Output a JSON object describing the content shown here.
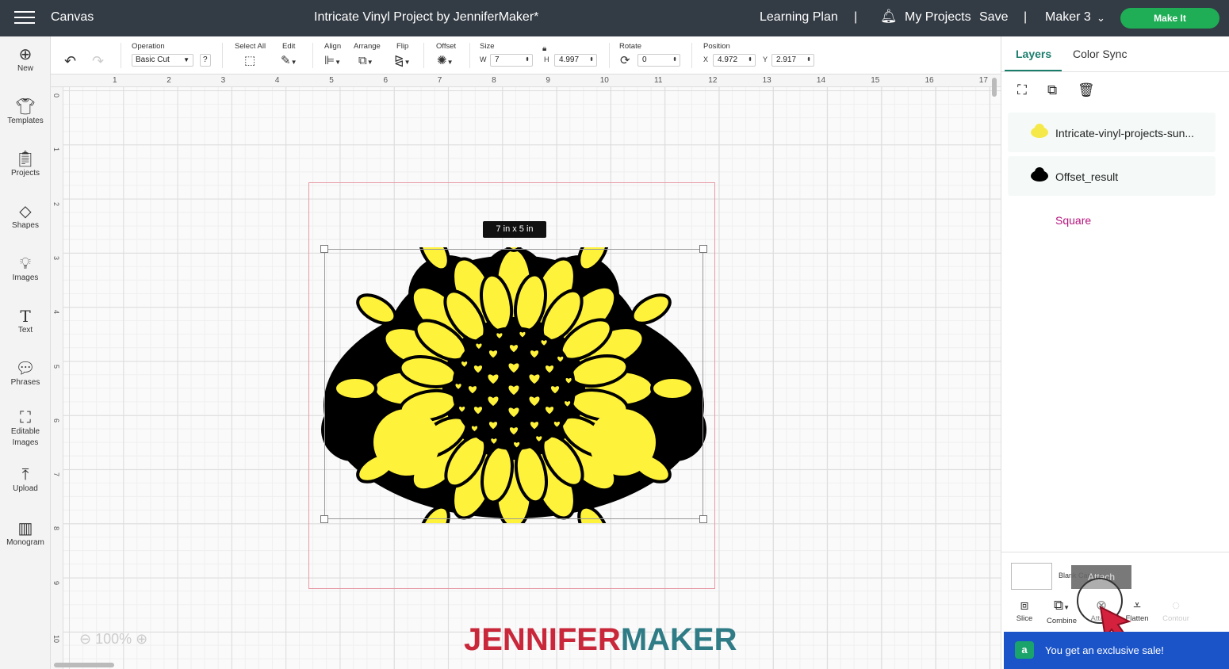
{
  "topbar": {
    "app_title": "Canvas",
    "project_title": "Intricate Vinyl Project by JenniferMaker*",
    "learning_plan": "Learning Plan",
    "sep1": "|",
    "my_projects": "My Projects",
    "save": "Save",
    "sep2": "|",
    "machine": "Maker 3",
    "make_it": "Make It"
  },
  "toolbar": {
    "operation_label": "Operation",
    "operation_value": "Basic Cut",
    "help": "?",
    "select_all_label": "Select All",
    "edit_label": "Edit",
    "align_label": "Align",
    "arrange_label": "Arrange",
    "flip_label": "Flip",
    "offset_label": "Offset",
    "size_label": "Size",
    "w_label": "W",
    "w_value": "7",
    "h_label": "H",
    "h_value": "4.997",
    "rotate_label": "Rotate",
    "rotate_value": "0",
    "position_label": "Position",
    "x_label": "X",
    "x_value": "4.972",
    "y_label": "Y",
    "y_value": "2.917"
  },
  "leftbar": {
    "items": [
      {
        "label": "New"
      },
      {
        "label": "Templates"
      },
      {
        "label": "Projects"
      },
      {
        "label": "Shapes"
      },
      {
        "label": "Images"
      },
      {
        "label": "Text"
      },
      {
        "label": "Phrases"
      },
      {
        "label": "Editable\nImages"
      },
      {
        "label": "Upload"
      },
      {
        "label": "Monogram"
      }
    ]
  },
  "ruler": {
    "top": [
      "1",
      "2",
      "3",
      "4",
      "5",
      "6",
      "7",
      "8",
      "9",
      "10",
      "11",
      "12",
      "13",
      "14",
      "15",
      "16",
      "17"
    ],
    "left": [
      "0",
      "1",
      "2",
      "3",
      "4",
      "5",
      "6",
      "7",
      "8",
      "9",
      "10"
    ]
  },
  "canvas": {
    "dimension_tag": "7 in x 5 in",
    "zoom": "100%",
    "watermark_a": "JENNIFER",
    "watermark_b": "MAKER"
  },
  "rightpanel": {
    "tabs": {
      "layers": "Layers",
      "color_sync": "Color Sync"
    },
    "layers": [
      {
        "name": "Intricate-vinyl-projects-sun...",
        "color": "#f5e94a"
      },
      {
        "name": "Offset_result",
        "color": "#000000"
      },
      {
        "name": "Square",
        "color": "#b5157e"
      }
    ],
    "blank_canvas": "Blank Canvas",
    "tooltip": "Attach",
    "tools": [
      {
        "label": "Slice"
      },
      {
        "label": "Combine"
      },
      {
        "label": "Attach"
      },
      {
        "label": "Flatten"
      },
      {
        "label": "Contour"
      }
    ]
  },
  "promo": {
    "badge": "a",
    "text": "You get an exclusive sale!"
  },
  "colors": {
    "accent_green": "#1fae56",
    "sunflower_yellow": "#fff23a",
    "header_bg": "#333b44",
    "watermark_red": "#c9273a",
    "watermark_teal": "#2f7c86"
  }
}
